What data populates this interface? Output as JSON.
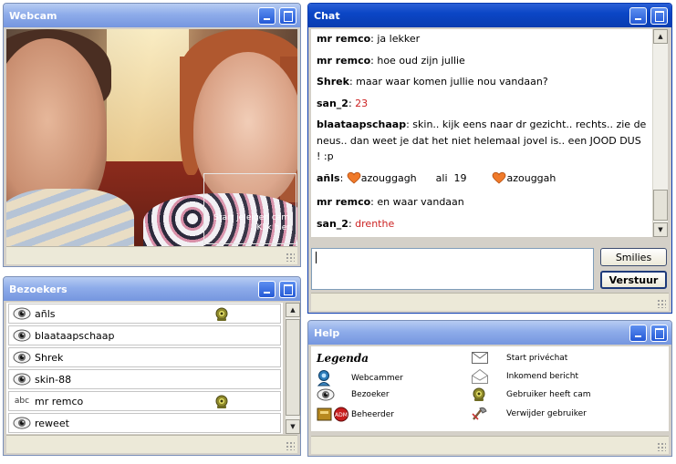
{
  "webcam": {
    "title": "Webcam",
    "overlay_line1": "Start je eigen cam.",
    "overlay_line2": "Klik hier."
  },
  "visitors": {
    "title": "Bezoekers",
    "items": [
      {
        "name": "añls",
        "icon": "eye-icon",
        "has_cam": true
      },
      {
        "name": "blaataapschaap",
        "icon": "eye-icon",
        "has_cam": false
      },
      {
        "name": "Shrek",
        "icon": "eye-icon",
        "has_cam": false
      },
      {
        "name": "skin-88",
        "icon": "eye-icon",
        "has_cam": false
      },
      {
        "name": "mr remco",
        "icon": "abc",
        "has_cam": true
      },
      {
        "name": "reweet",
        "icon": "eye-icon",
        "has_cam": false
      }
    ]
  },
  "chat": {
    "title": "Chat",
    "messages": [
      {
        "user": "mr remco",
        "text": "ja lekker"
      },
      {
        "user": "mr remco",
        "text": "hoe oud zijn jullie"
      },
      {
        "user": "Shrek",
        "text": "maar waar komen jullie nou vandaan?"
      },
      {
        "user": "san_2",
        "text": "23",
        "color": "#cc2222"
      },
      {
        "user": "blaataapschaap",
        "text": "skin.. kijk eens naar dr gezicht.. rechts.. zie de neus.. dan weet je dat het niet helemaal jovel is.. een JOOD DUS ! :p"
      },
      {
        "user": "añls",
        "text_a": "azouggagh",
        "text_mid": "ali  19",
        "text_b": "azouggah"
      },
      {
        "user": "mr remco",
        "text": "en waar vandaan"
      },
      {
        "user": "san_2",
        "text": "drenthe",
        "color": "#cc2222"
      }
    ],
    "input_value": "",
    "smilies_label": "Smilies",
    "send_label": "Verstuur"
  },
  "help": {
    "title": "Help",
    "legend_title": "Legenda",
    "left": [
      {
        "icon": "webcammer-icon",
        "label": "Webcammer"
      },
      {
        "icon": "eye-icon",
        "label": "Bezoeker"
      },
      {
        "icon": "admin-icon",
        "label": "Beheerder"
      }
    ],
    "right": [
      {
        "icon": "envelope-icon",
        "label": "Start privéchat"
      },
      {
        "icon": "open-envelope-icon",
        "label": "Inkomend bericht"
      },
      {
        "icon": "cam-icon",
        "label": "Gebruiker heeft cam"
      },
      {
        "icon": "remove-user-icon",
        "label": "Verwijder gebruiker"
      }
    ]
  },
  "colors": {
    "titlebar_active": "#0a3cb0",
    "titlebar_inactive": "#8eacea",
    "panel_bg": "#d4d0c8",
    "highlight_red": "#cc2222"
  }
}
